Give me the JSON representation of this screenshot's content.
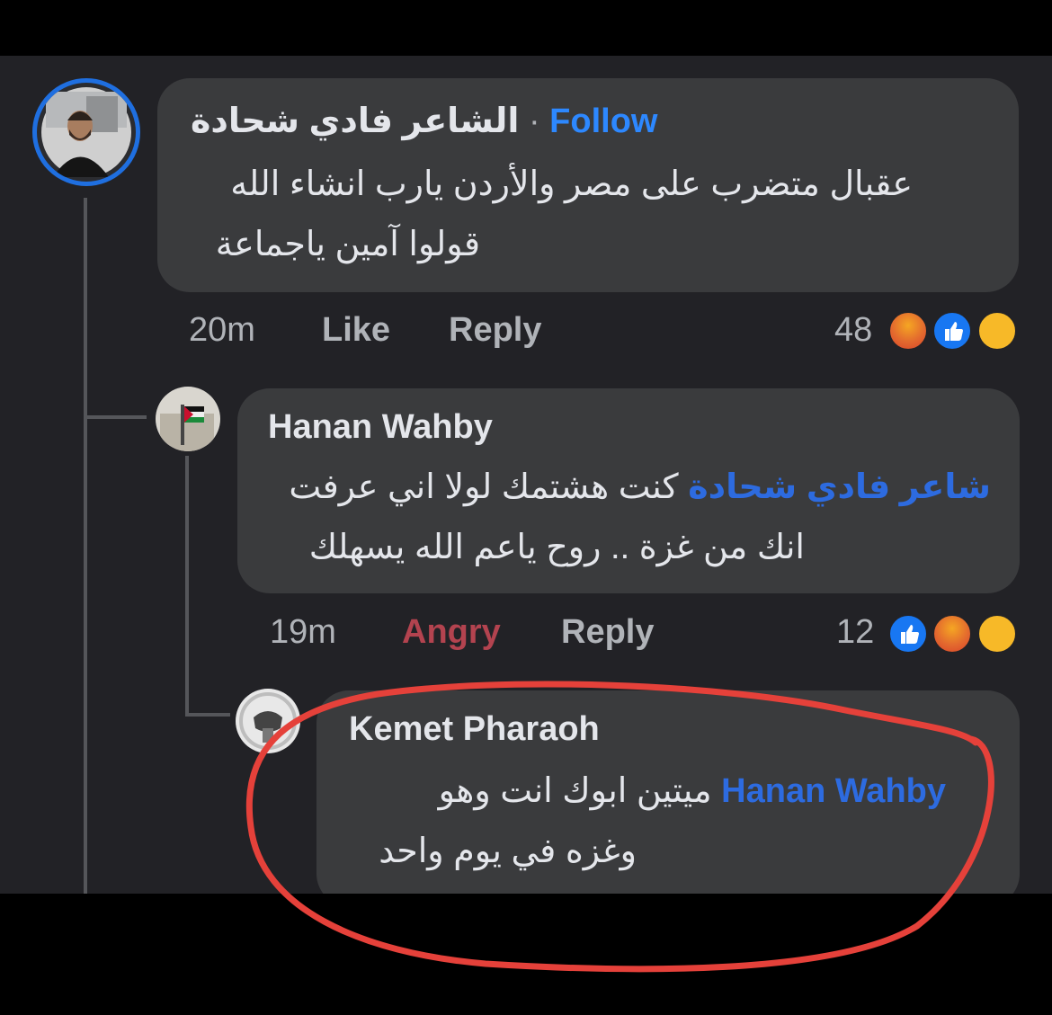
{
  "comments": [
    {
      "author": "الشاعر فادي شحادة",
      "separator": "·",
      "follow_label": "Follow",
      "lines": [
        "عقبال متضرب على مصر والأردن يارب انشاء الله",
        "قولوا آمين ياجماعة"
      ],
      "time": "20m",
      "like_label": "Like",
      "reply_label": "Reply",
      "reaction_count": "48",
      "reactions": [
        "angry-icon",
        "like-icon",
        "care-icon"
      ]
    },
    {
      "author": "Hanan Wahby",
      "mention": "شاعر فادي شحادة",
      "line1_text": "كنت هشتمك لولا اني عرفت",
      "line2": "انك من غزة .. روح ياعم الله يسهلك",
      "time": "19m",
      "reaction_label": "Angry",
      "reply_label": "Reply",
      "reaction_count": "12",
      "reactions": [
        "like-icon",
        "angry-icon",
        "care-icon"
      ]
    },
    {
      "author": "Kemet Pharaoh",
      "mention": "Hanan Wahby",
      "line1_text": "ميتين  ابوك انت وهو",
      "line2": "وغزه في يوم واحد"
    }
  ],
  "colors": {
    "background": "#222226",
    "bubble": "#3a3b3d",
    "link": "#2d88ff",
    "angry": "#b3434f",
    "annotation": "#e5413a"
  }
}
